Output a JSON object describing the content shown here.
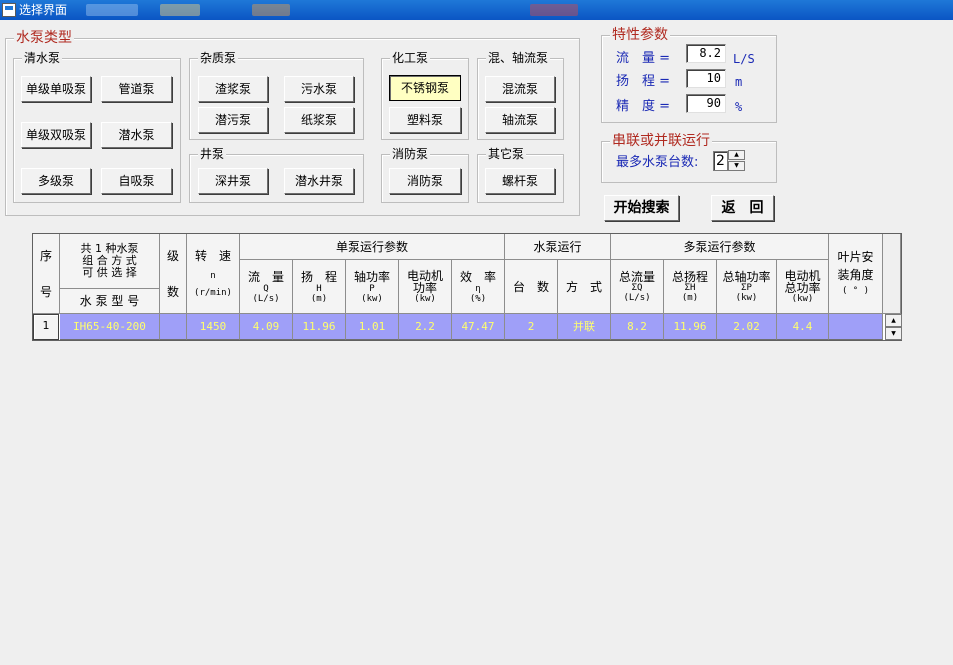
{
  "window": {
    "title": "选择界面"
  },
  "pump_types": {
    "caption": "水泵类型",
    "clean": {
      "caption": "清水泵",
      "btns": [
        "单级单吸泵",
        "管道泵",
        "单级双吸泵",
        "潜水泵",
        "多级泵",
        "自吸泵"
      ]
    },
    "impurity": {
      "caption": "杂质泵",
      "btns": [
        "渣浆泵",
        "污水泵",
        "潜污泵",
        "纸浆泵"
      ]
    },
    "chemical": {
      "caption": "化工泵",
      "btns": [
        "不锈钢泵",
        "塑料泵"
      ]
    },
    "mixed": {
      "caption": "混、轴流泵",
      "btns": [
        "混流泵",
        "轴流泵"
      ]
    },
    "well": {
      "caption": "井泵",
      "btns": [
        "深井泵",
        "潜水井泵"
      ]
    },
    "fire": {
      "caption": "消防泵",
      "btns": [
        "消防泵"
      ]
    },
    "other": {
      "caption": "其它泵",
      "btns": [
        "螺杆泵"
      ]
    }
  },
  "characteristics": {
    "caption": "特性参数",
    "flow": {
      "label": "流　量 =",
      "value": "8.2",
      "unit": "L/S"
    },
    "head": {
      "label": "扬　程 =",
      "value": "10",
      "unit": "m"
    },
    "precision": {
      "label": "精　度 =",
      "value": "90",
      "unit": "%"
    }
  },
  "series_parallel": {
    "caption": "串联或并联运行",
    "label": "最多水泵台数:",
    "value": "2"
  },
  "actions": {
    "search": "开始搜索",
    "back": "返　回"
  },
  "table": {
    "h_index": [
      "序",
      "号"
    ],
    "h_combo": [
      "共 1 种水泵",
      "组 合 方 式",
      "可 供 选 择"
    ],
    "h_model": "水 泵 型 号",
    "h_stage": [
      "级",
      "数"
    ],
    "h_speed": [
      "转　速",
      "n",
      "(r/min)"
    ],
    "h_single_group": "单泵运行参数",
    "h_pump_run_group": "水泵运行",
    "h_multi_group": "多泵运行参数",
    "h_blade": [
      "叶片安",
      "装角度",
      "( ° )"
    ],
    "single_cols": [
      {
        "lines": [
          "流　量"
        ],
        "sym": "Q",
        "unit": "(L/s)"
      },
      {
        "lines": [
          "扬　程"
        ],
        "sym": "H",
        "unit": "(m)"
      },
      {
        "lines": [
          "轴功率"
        ],
        "sym": "P",
        "unit": "(kw)"
      },
      {
        "lines": [
          "电动机",
          "功率"
        ],
        "sym": "",
        "unit": "(kw)"
      },
      {
        "lines": [
          "效　率"
        ],
        "sym": "η",
        "unit": "(%)"
      }
    ],
    "run_cols": [
      "台　数",
      "方　式"
    ],
    "multi_cols": [
      {
        "lines": [
          "总流量"
        ],
        "sym": "ΣQ",
        "unit": "(L/s)"
      },
      {
        "lines": [
          "总扬程"
        ],
        "sym": "ΣH",
        "unit": "(m)"
      },
      {
        "lines": [
          "总轴功率"
        ],
        "sym": "ΣP",
        "unit": "(kw)"
      },
      {
        "lines": [
          "电动机",
          "总功率"
        ],
        "sym": "",
        "unit": "(kw)"
      }
    ],
    "rows": [
      {
        "index": "1",
        "model": "IH65-40-200",
        "stage": "",
        "speed": "1450",
        "q": "4.09",
        "h": "11.96",
        "p": "1.01",
        "motor": "2.2",
        "eff": "47.47",
        "count": "2",
        "mode": "并联",
        "tq": "8.2",
        "th": "11.96",
        "tp": "2.02",
        "tmotor": "4.4",
        "blade": ""
      }
    ]
  },
  "colors": {
    "accent_caption": "#b02a20",
    "label_blue": "#1b2ab5",
    "row_bg": "#9f9ff8",
    "row_text": "#ffff6e",
    "selected_btn": "#ffffc2"
  },
  "icons": {
    "app": "window-app-icon",
    "up": "scroll-up-arrow-icon",
    "down": "scroll-down-arrow-icon"
  }
}
